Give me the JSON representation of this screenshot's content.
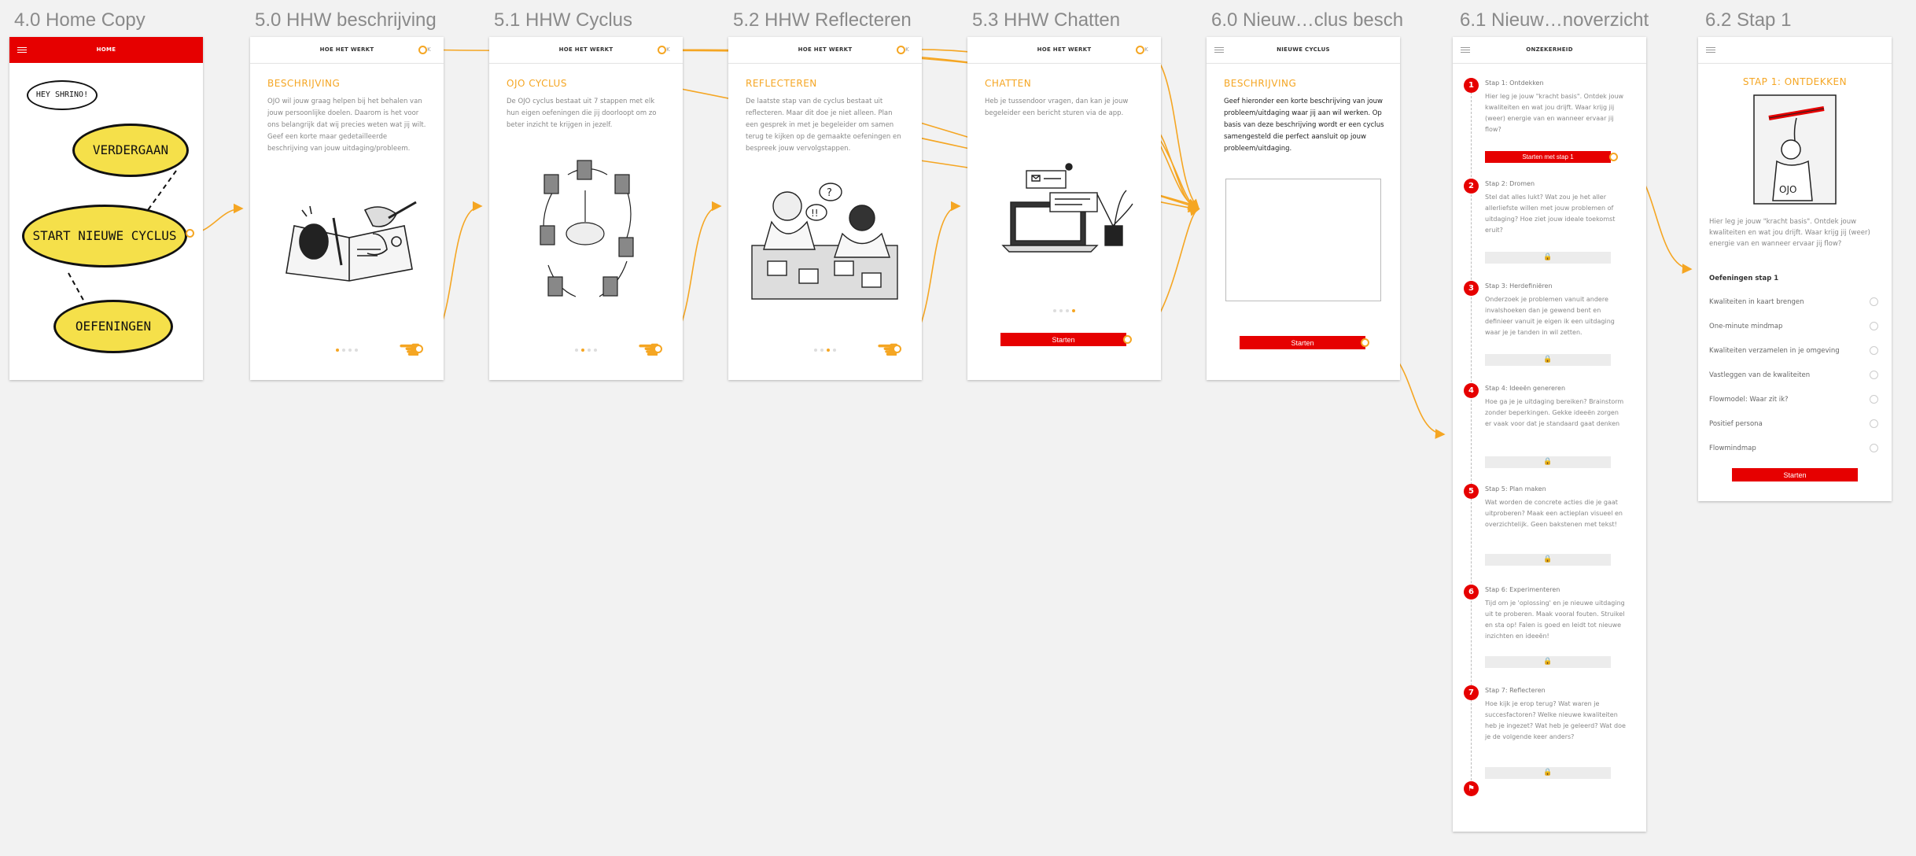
{
  "artboards": [
    {
      "title": "4.0 Home Copy"
    },
    {
      "title": "5.0 HHW beschrijving"
    },
    {
      "title": "5.1 HHW Cyclus"
    },
    {
      "title": "5.2 HHW Reflecteren"
    },
    {
      "title": "5.3 HHW Chatten"
    },
    {
      "title": "6.0 Nieuw…clus besch"
    },
    {
      "title": "6.1 Nieuw…noverzicht"
    },
    {
      "title": "6.2 Stap 1"
    }
  ],
  "home": {
    "header": "HOME",
    "greeting": "HEY SHRINO!",
    "bubbles": [
      "VERDERGAAN",
      "START NIEUWE CYCLUS",
      "OEFENINGEN"
    ]
  },
  "hhw": {
    "header": "HOE HET WERKT",
    "back": "OK",
    "beschrijving": {
      "title": "BESCHRIJVING",
      "body": "OJO wil jouw graag helpen bij het behalen van jouw persoonlijke doelen. Daarom is het voor ons belangrijk dat wij precies weten wat jij wilt. Geef een korte maar gedetailleerde beschrijving van jouw uitdaging/probleem."
    },
    "cyclus": {
      "title": "OJO CYCLUS",
      "body": "De OJO cyclus bestaat uit 7 stappen met elk hun eigen oefeningen die jij doorloopt om zo beter inzicht te krijgen in jezelf."
    },
    "reflecteren": {
      "title": "REFLECTEREN",
      "body": "De laatste stap van de cyclus bestaat uit reflecteren. Maar dit doe je niet alleen. Plan een gesprek in met je begeleider om samen terug te kijken op de gemaakte oefeningen en bespreek jouw vervolgstappen."
    },
    "chatten": {
      "title": "CHATTEN",
      "body": "Heb je tussendoor vragen, dan kan je jouw begeleider een bericht sturen via de app.",
      "button": "Starten"
    }
  },
  "nieuwe_cyclus": {
    "header": "NIEUWE CYCLUS",
    "title": "BESCHRIJVING",
    "body": "Geef hieronder een korte beschrijving van jouw probleem/uitdaging waar jij aan wil werken. Op basis van deze beschrijving wordt er een cyclus samengesteld die perfect aansluit op jouw probleem/uitdaging.",
    "button": "Starten"
  },
  "overzicht": {
    "header": "ONZEKERHEID",
    "steps": [
      {
        "num": "1",
        "title": "Stap 1: Ontdekken",
        "desc": "Hier leg je jouw \"kracht basis\". Ontdek jouw kwaliteiten en wat jou drijft. Waar krijg jij (weer) energie van en wanneer ervaar jij flow?",
        "button": "Starten met stap 1"
      },
      {
        "num": "2",
        "title": "Stap 2: Dromen",
        "desc": "Stel dat alles lukt? Wat zou je het aller allerliefste willen met jouw problemen of uitdaging? Hoe ziet jouw ideale toekomst eruit?",
        "lock": "🔒"
      },
      {
        "num": "3",
        "title": "Stap 3: Herdefiniëren",
        "desc": "Onderzoek je problemen vanuit andere invalshoeken dan je gewend bent en definieer vanuit je eigen ik een uitdaging waar je je tanden in wil zetten.",
        "lock": "🔒"
      },
      {
        "num": "4",
        "title": "Stap 4: Ideeën genereren",
        "desc": "Hoe ga je je uitdaging bereiken? Brainstorm zonder beperkingen. Gekke ideeën zorgen er vaak voor dat je standaard gaat denken",
        "lock": "🔒"
      },
      {
        "num": "5",
        "title": "Stap 5: Plan maken",
        "desc": "Wat worden de concrete acties die je gaat uitproberen? Maak een actieplan visueel en overzichtelijk. Geen bakstenen met tekst!",
        "lock": "🔒"
      },
      {
        "num": "6",
        "title": "Stap 6: Experimenteren",
        "desc": "Tijd om je 'oplossing' en je nieuwe uitdaging uit te proberen. Maak vooral fouten. Struikel en sta op! Falen is goed en leidt tot nieuwe inzichten en ideeën!",
        "lock": "🔒"
      },
      {
        "num": "7",
        "title": "Stap 7: Reflecteren",
        "desc": "Hoe kijk je erop terug? Wat waren je succesfactoren? Welke nieuwe kwaliteiten heb je ingezet? Wat heb je geleerd? Wat doe je de volgende keer anders?",
        "lock": "🔒"
      }
    ],
    "finish_icon": "flag-icon"
  },
  "stap1": {
    "title": "STAP 1: ONTDEKKEN",
    "body": "Hier leg je jouw \"kracht basis\". Ontdek jouw kwaliteiten en wat jou drijft. Waar krijg jij (weer) energie van en wanneer ervaar jij flow?",
    "exercises_title": "Oefeningen stap 1",
    "exercises": [
      "Kwaliteiten in kaart brengen",
      "One-minute mindmap",
      "Kwaliteiten verzamelen in je omgeving",
      "Vastleggen van de kwaliteiten",
      "Flowmodel: Waar zit ik?",
      "Positief persona",
      "Flowmindmap"
    ],
    "button": "Starten"
  },
  "colors": {
    "accent": "#f5a623",
    "brand": "#e60000",
    "bubble": "#f5e04a"
  }
}
